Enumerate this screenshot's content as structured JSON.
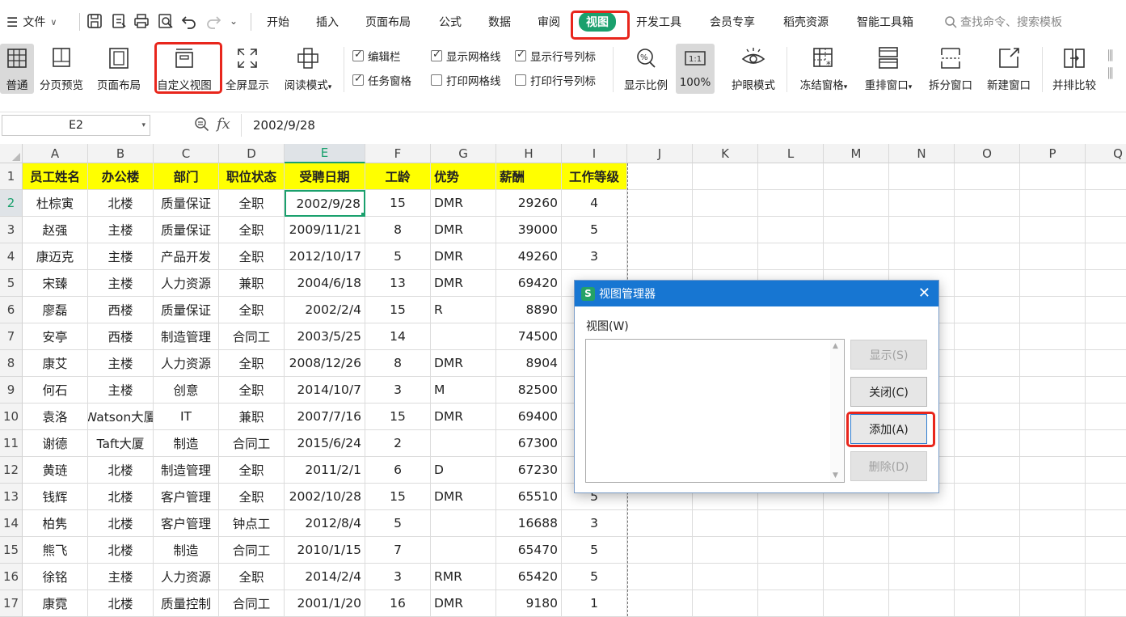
{
  "menubar": {
    "file_label": "文件",
    "tabs": [
      "开始",
      "插入",
      "页面布局",
      "公式",
      "数据",
      "审阅",
      "视图",
      "开发工具",
      "会员专享",
      "稻壳资源",
      "智能工具箱"
    ],
    "active_tab": "视图",
    "search_placeholder": "查找命令、搜索模板"
  },
  "ribbon": {
    "buttons": {
      "normal": "普通",
      "page_break_preview": "分页预览",
      "page_layout": "页面布局",
      "custom_view": "自定义视图",
      "full_screen": "全屏显示",
      "reading_mode": "阅读模式",
      "zoom": "显示比例",
      "zoom_100": "100%",
      "eye_protection": "护眼模式",
      "freeze_panes": "冻结窗格",
      "arrange_windows": "重排窗口",
      "split_window": "拆分窗口",
      "new_window": "新建窗口",
      "side_by_side": "并排比较"
    },
    "checkboxes": [
      {
        "label": "编辑栏",
        "checked": true
      },
      {
        "label": "任务窗格",
        "checked": true
      },
      {
        "label": "显示网格线",
        "checked": true
      },
      {
        "label": "打印网格线",
        "checked": false
      },
      {
        "label": "显示行号列标",
        "checked": true
      },
      {
        "label": "打印行号列标",
        "checked": false
      }
    ]
  },
  "formula_bar": {
    "name_box": "E2",
    "fx": "fx",
    "value": "2002/9/28"
  },
  "sheet": {
    "columns": [
      "A",
      "B",
      "C",
      "D",
      "E",
      "F",
      "G",
      "H",
      "I",
      "J",
      "K",
      "L",
      "M",
      "N",
      "O",
      "P",
      "Q"
    ],
    "row_numbers": [
      "1",
      "2",
      "3",
      "4",
      "5",
      "6",
      "7",
      "8",
      "9",
      "10",
      "11",
      "12",
      "13",
      "14",
      "15",
      "16",
      "17"
    ],
    "header": [
      "员工姓名",
      "办公楼",
      "部门",
      "职位状态",
      "受聘日期",
      "工龄",
      "优势",
      "薪酬",
      "工作等级"
    ],
    "rows": [
      [
        "杜棕寅",
        "北楼",
        "质量保证",
        "全职",
        "2002/9/28",
        "15",
        "DMR",
        "29260",
        "4"
      ],
      [
        "赵强",
        "主楼",
        "质量保证",
        "全职",
        "2009/11/21",
        "8",
        "DMR",
        "39000",
        "5"
      ],
      [
        "康迈克",
        "主楼",
        "产品开发",
        "全职",
        "2012/10/17",
        "5",
        "DMR",
        "49260",
        "3"
      ],
      [
        "宋臻",
        "主楼",
        "人力资源",
        "兼职",
        "2004/6/18",
        "13",
        "DMR",
        "69420",
        ""
      ],
      [
        "廖磊",
        "西楼",
        "质量保证",
        "全职",
        "2002/2/4",
        "15",
        "R",
        "8890",
        ""
      ],
      [
        "安亭",
        "西楼",
        "制造管理",
        "合同工",
        "2003/5/25",
        "14",
        "",
        "74500",
        ""
      ],
      [
        "康艾",
        "主楼",
        "人力资源",
        "全职",
        "2008/12/26",
        "8",
        "DMR",
        "8904",
        ""
      ],
      [
        "何石",
        "主楼",
        "创意",
        "全职",
        "2014/10/7",
        "3",
        "M",
        "82500",
        ""
      ],
      [
        "袁洛",
        "Watson大厦",
        "IT",
        "兼职",
        "2007/7/16",
        "15",
        "DMR",
        "69400",
        ""
      ],
      [
        "谢德",
        "Taft大厦",
        "制造",
        "合同工",
        "2015/6/24",
        "2",
        "",
        "67300",
        ""
      ],
      [
        "黄琏",
        "北楼",
        "制造管理",
        "全职",
        "2011/2/1",
        "6",
        "D",
        "67230",
        ""
      ],
      [
        "钱辉",
        "北楼",
        "客户管理",
        "全职",
        "2002/10/28",
        "15",
        "DMR",
        "65510",
        "5"
      ],
      [
        "柏隽",
        "北楼",
        "客户管理",
        "钟点工",
        "2012/8/4",
        "5",
        "",
        "16688",
        "3"
      ],
      [
        "熊飞",
        "北楼",
        "制造",
        "合同工",
        "2010/1/15",
        "7",
        "",
        "65470",
        "5"
      ],
      [
        "徐铭",
        "主楼",
        "人力资源",
        "全职",
        "2014/2/4",
        "3",
        "RMR",
        "65420",
        "5"
      ],
      [
        "康霓",
        "北楼",
        "质量控制",
        "合同工",
        "2001/1/20",
        "16",
        "DMR",
        "9180",
        "1"
      ]
    ]
  },
  "dialog": {
    "title": "视图管理器",
    "list_label": "视图(W)",
    "buttons": {
      "show": "显示(S)",
      "close": "关闭(C)",
      "add": "添加(A)",
      "delete": "删除(D)"
    }
  },
  "colors": {
    "accent_green": "#1aa06d",
    "highlight_red": "#e8261c",
    "header_yellow": "#ffff00",
    "dialog_blue": "#1776d2"
  }
}
